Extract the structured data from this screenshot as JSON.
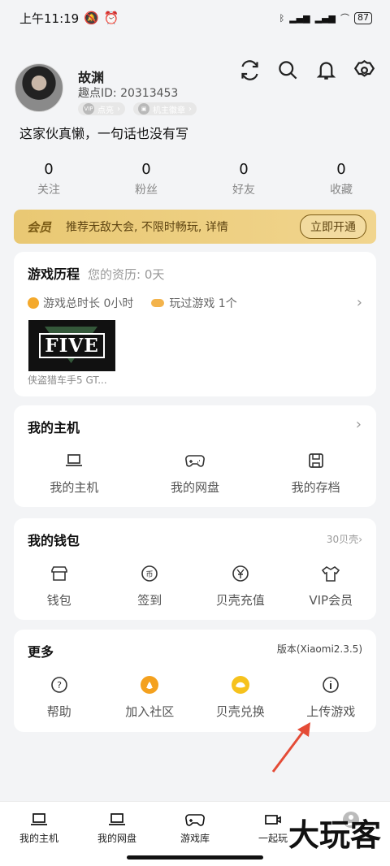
{
  "status": {
    "time": "上午11:19",
    "battery": "87"
  },
  "profile": {
    "name": "故渊",
    "uid": "趣点ID: 20313453",
    "badge1": "点亮",
    "badge2": "机主徽章",
    "bio": "这家伙真懒，一句话也没有写"
  },
  "stats": [
    {
      "value": "0",
      "label": "关注"
    },
    {
      "value": "0",
      "label": "粉丝"
    },
    {
      "value": "0",
      "label": "好友"
    },
    {
      "value": "0",
      "label": "收藏"
    }
  ],
  "vip": {
    "title": "会员",
    "text": "推荐无敌大会, 不限时畅玩, 详情",
    "button": "立即开通"
  },
  "history": {
    "title": "游戏历程",
    "qualification": "您的资历: 0天",
    "play_time": "游戏总时长 0小时",
    "played_games": "玩过游戏 1个",
    "game_title": "侠盗猎车手5 GT...",
    "thumbnail_text": "FIVE"
  },
  "host": {
    "title": "我的主机",
    "items": [
      "我的主机",
      "我的网盘",
      "我的存档"
    ]
  },
  "wallet": {
    "title": "我的钱包",
    "shells": "30贝壳",
    "items": [
      "钱包",
      "签到",
      "贝壳充值",
      "VIP会员"
    ]
  },
  "more": {
    "title": "更多",
    "version": "版本(Xiaomi2.3.5)",
    "items": [
      "帮助",
      "加入社区",
      "贝壳兑换",
      "上传游戏"
    ]
  },
  "bottom_nav": [
    "我的主机",
    "我的网盘",
    "游戏库",
    "一起玩"
  ],
  "watermark": "大玩客",
  "colors": {
    "accent": "#f1d58e",
    "orange": "#f4a92c",
    "arrow": "#e44b36"
  }
}
